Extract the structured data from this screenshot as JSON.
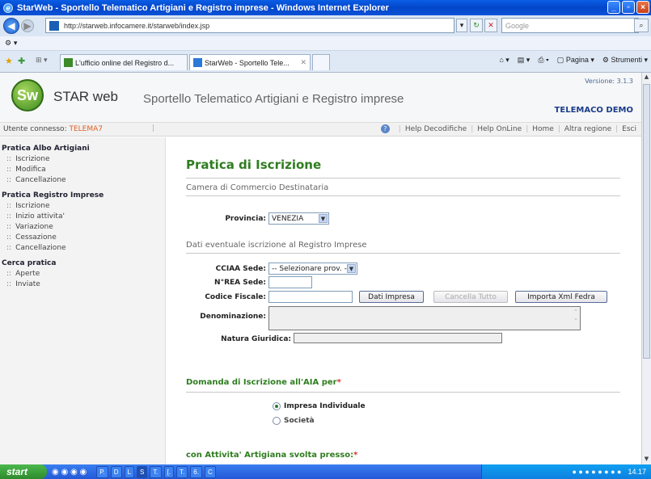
{
  "window": {
    "title": "StarWeb - Sportello Telematico Artigiani e Registro imprese - Windows Internet Explorer"
  },
  "browser": {
    "url": "http://starweb.infocamere.it/starweb/index.jsp",
    "search_placeholder": "Google",
    "tabs": [
      {
        "label": "L'ufficio online del Registro d...",
        "active": false
      },
      {
        "label": "StarWeb - Sportello Tele...",
        "active": true
      }
    ],
    "toolbar_right": {
      "page": "Pagina",
      "tools": "Strumenti"
    }
  },
  "header": {
    "logo_text": "Sw",
    "brand": "STAR web",
    "app_title": "Sportello Telematico Artigiani e Registro imprese",
    "version": "Versione: 3.1.3",
    "environment": "TELEMACO DEMO"
  },
  "userbar": {
    "label": "Utente connesso:",
    "user": "TELEMA7",
    "links": [
      "Help Decodifiche",
      "Help OnLine",
      "Home",
      "Altra regione",
      "Esci"
    ]
  },
  "sidebar": {
    "sections": [
      {
        "title": "Pratica Albo Artigiani",
        "items": [
          "Iscrizione",
          "Modifica",
          "Cancellazione"
        ]
      },
      {
        "title": "Pratica Registro Imprese",
        "items": [
          "Iscrizione",
          "Inizio attivita'",
          "Variazione",
          "Cessazione",
          "Cancellazione"
        ]
      },
      {
        "title": "Cerca pratica",
        "items": [
          "Aperte",
          "Inviate"
        ]
      }
    ]
  },
  "main": {
    "title": "Pratica di Iscrizione",
    "camera_section": "Camera di Commercio Destinataria",
    "provincia_label": "Provincia:",
    "provincia_value": "VENEZIA",
    "registro_section": "Dati eventuale iscrizione al Registro Imprese",
    "cciaa_label": "CCIAA Sede:",
    "cciaa_value": "-- Selezionare prov. --",
    "nrea_label": "N°REA Sede:",
    "cf_label": "Codice Fiscale:",
    "btn_dati": "Dati Impresa",
    "btn_cancella": "Cancella Tutto",
    "btn_importa": "Importa Xml Fedra",
    "denominazione_label": "Denominazione:",
    "natura_label": "Natura Giuridica:",
    "domanda_heading": "Domanda di Iscrizione all'AIA per",
    "radio_individuale": "Impresa Individuale",
    "radio_societa": "Società",
    "attivita_heading": "con Attivita' Artigiana svolta presso:",
    "required_mark": "*"
  },
  "taskbar": {
    "start": "start",
    "items": [
      "P.",
      "D",
      "L",
      "S",
      "T.",
      "[.",
      "T.",
      "6.",
      "C"
    ],
    "clock": "14.17"
  }
}
